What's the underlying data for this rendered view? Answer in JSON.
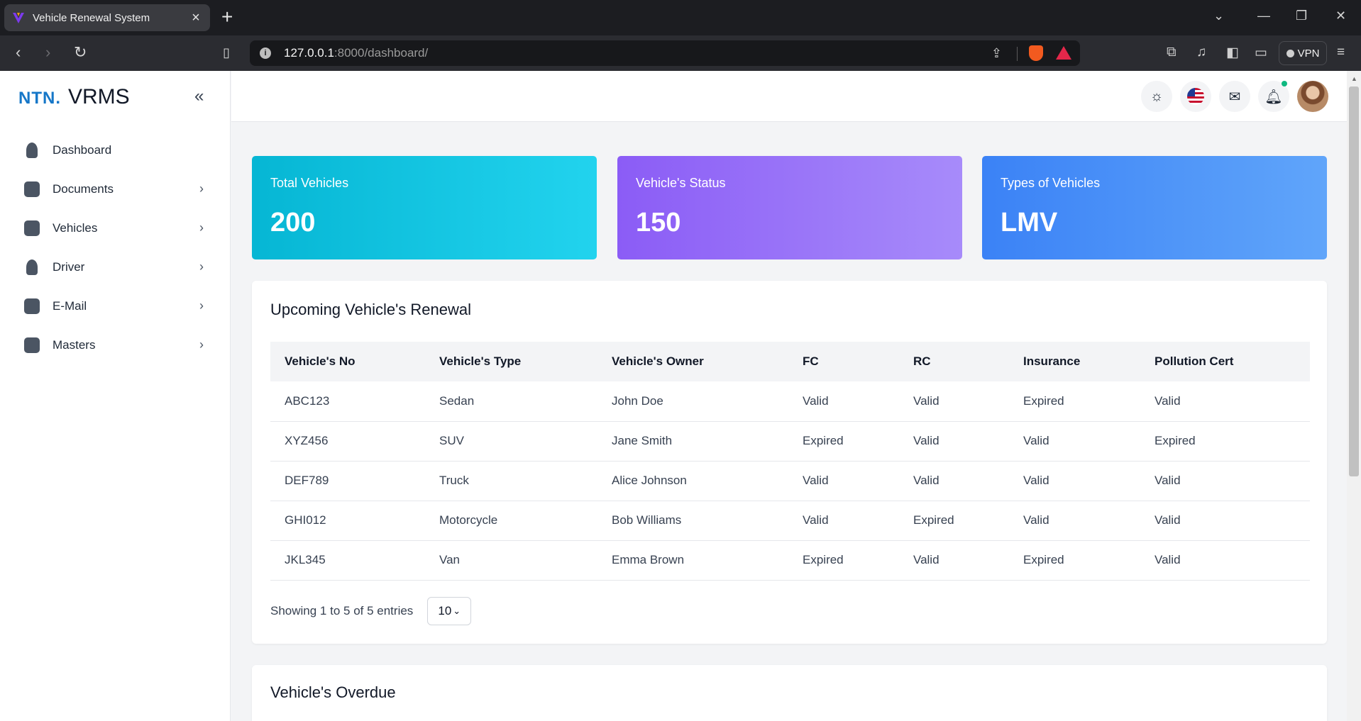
{
  "browser": {
    "tab_title": "Vehicle Renewal System",
    "url_host": "127.0.0.1",
    "url_path": ":8000/dashboard/",
    "vpn_label": "VPN"
  },
  "brand": {
    "short": "NTN.",
    "name": "VRMS"
  },
  "sidebar": {
    "items": [
      {
        "label": "Dashboard",
        "icon": "dashboard-icon"
      },
      {
        "label": "Documents",
        "icon": "documents-icon"
      },
      {
        "label": "Vehicles",
        "icon": "bus-icon"
      },
      {
        "label": "Driver",
        "icon": "user-icon"
      },
      {
        "label": "E-Mail",
        "icon": "mail-icon"
      },
      {
        "label": "Masters",
        "icon": "share-icon"
      }
    ]
  },
  "cards": [
    {
      "title": "Total Vehicles",
      "value": "200",
      "color_start": "#06b6d4",
      "color_end": "#22d3ee"
    },
    {
      "title": "Vehicle's Status",
      "value": "150",
      "color_start": "#8b5cf6",
      "color_end": "#a78bfa"
    },
    {
      "title": "Types of Vehicles",
      "value": "LMV",
      "color_start": "#3b82f6",
      "color_end": "#60a5fa"
    }
  ],
  "renewal": {
    "title": "Upcoming Vehicle's Renewal",
    "columns": [
      "Vehicle's No",
      "Vehicle's Type",
      "Vehicle's Owner",
      "FC",
      "RC",
      "Insurance",
      "Pollution Cert"
    ],
    "rows": [
      [
        "ABC123",
        "Sedan",
        "John Doe",
        "Valid",
        "Valid",
        "Expired",
        "Valid"
      ],
      [
        "XYZ456",
        "SUV",
        "Jane Smith",
        "Expired",
        "Valid",
        "Valid",
        "Expired"
      ],
      [
        "DEF789",
        "Truck",
        "Alice Johnson",
        "Valid",
        "Valid",
        "Valid",
        "Valid"
      ],
      [
        "GHI012",
        "Motorcycle",
        "Bob Williams",
        "Valid",
        "Expired",
        "Valid",
        "Valid"
      ],
      [
        "JKL345",
        "Van",
        "Emma Brown",
        "Expired",
        "Valid",
        "Expired",
        "Valid"
      ]
    ],
    "showing": "Showing 1 to 5 of 5 entries",
    "page_size": "10"
  },
  "overdue": {
    "title": "Vehicle's Overdue"
  }
}
